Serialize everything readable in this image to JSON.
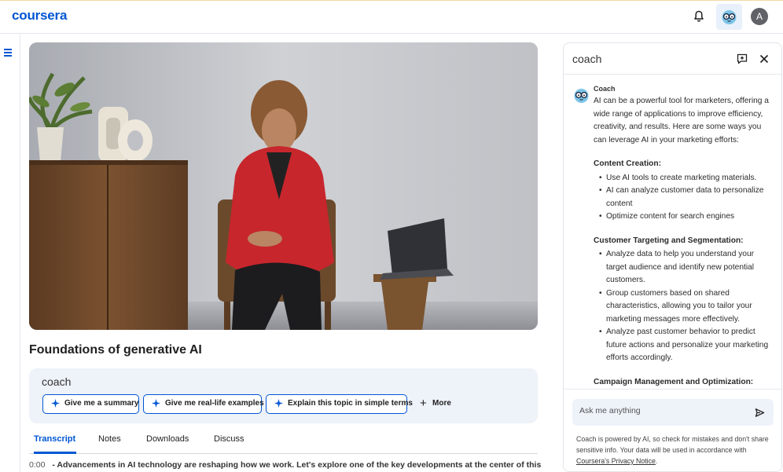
{
  "header": {
    "logo": "coursera",
    "avatar_initial": "A",
    "icons": [
      "bell-icon",
      "coach-mascot-icon"
    ]
  },
  "nav": {
    "menu_icon": "hamburger-icon"
  },
  "lesson": {
    "title": "Foundations of generative AI"
  },
  "coach_bar": {
    "label": "coach",
    "chips": [
      "Give me a summary",
      "Give me real-life examples",
      "Explain this topic in simple terms"
    ],
    "more_label": "More"
  },
  "tabs": [
    "Transcript",
    "Notes",
    "Downloads",
    "Discuss"
  ],
  "active_tab": "Transcript",
  "transcript": {
    "timestamp": "0:00",
    "text": "- Advancements in AI technology are reshaping how we work. Let's explore one of the key developments at the center of this"
  },
  "coach_panel": {
    "title": "coach",
    "sender": "Coach",
    "intro": "AI can be a powerful tool for marketers, offering a wide range of applications to improve efficiency, creativity, and results. Here are some ways you can leverage AI in your marketing efforts:",
    "sections": [
      {
        "heading": "Content Creation:",
        "items": [
          "Use AI tools to create marketing materials.",
          "AI can analyze customer data to personalize content",
          "Optimize content for search engines"
        ]
      },
      {
        "heading": "Customer Targeting and Segmentation:",
        "items": [
          "Analyze data to help you understand your target audience and identify new potential customers.",
          "Group customers based on shared characteristics, allowing you to tailor your marketing messages more effectively.",
          "Analyze past customer behavior to predict future actions and personalize your marketing efforts accordingly."
        ]
      },
      {
        "heading": "Campaign Management and Optimization:",
        "items": []
      }
    ],
    "input_placeholder": "Ask me anything",
    "disclaimer_text": "Coach is powered by AI, so check for mistakes and don't share sensitive info. Your data will be used in accordance with ",
    "privacy_link": "Coursera's Privacy Notice",
    "disclaimer_end": "."
  },
  "colors": {
    "brand": "#0056d2",
    "coach_bg": "#eef2f9"
  }
}
